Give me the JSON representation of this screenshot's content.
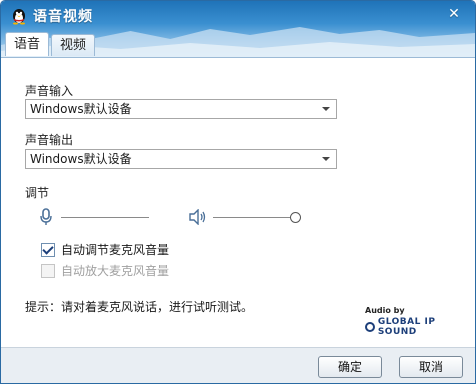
{
  "window": {
    "title": "语音视频",
    "close_glyph": "✕"
  },
  "tabs": [
    {
      "label": "语音",
      "active": true
    },
    {
      "label": "视频",
      "active": false
    }
  ],
  "input": {
    "label": "声音输入",
    "selected": "Windows默认设备"
  },
  "output": {
    "label": "声音输出",
    "selected": "Windows默认设备"
  },
  "adjust": {
    "label": "调节",
    "mic_icon": "microphone-icon",
    "speaker_icon": "speaker-icon",
    "speaker_level": 1.0
  },
  "options": {
    "auto_adjust": {
      "label": "自动调节麦克风音量",
      "checked": true,
      "enabled": true
    },
    "auto_amplify": {
      "label": "自动放大麦克风音量",
      "checked": false,
      "enabled": false
    }
  },
  "hint": "提示：请对着麦克风说话，进行试听测试。",
  "brand": {
    "small": "Audio by",
    "main": "GLOBAL IP SOUND"
  },
  "buttons": {
    "ok": "确定",
    "cancel": "取消"
  },
  "colors": {
    "titlebar": "#1f73b8",
    "accent": "#1d3f7a"
  }
}
